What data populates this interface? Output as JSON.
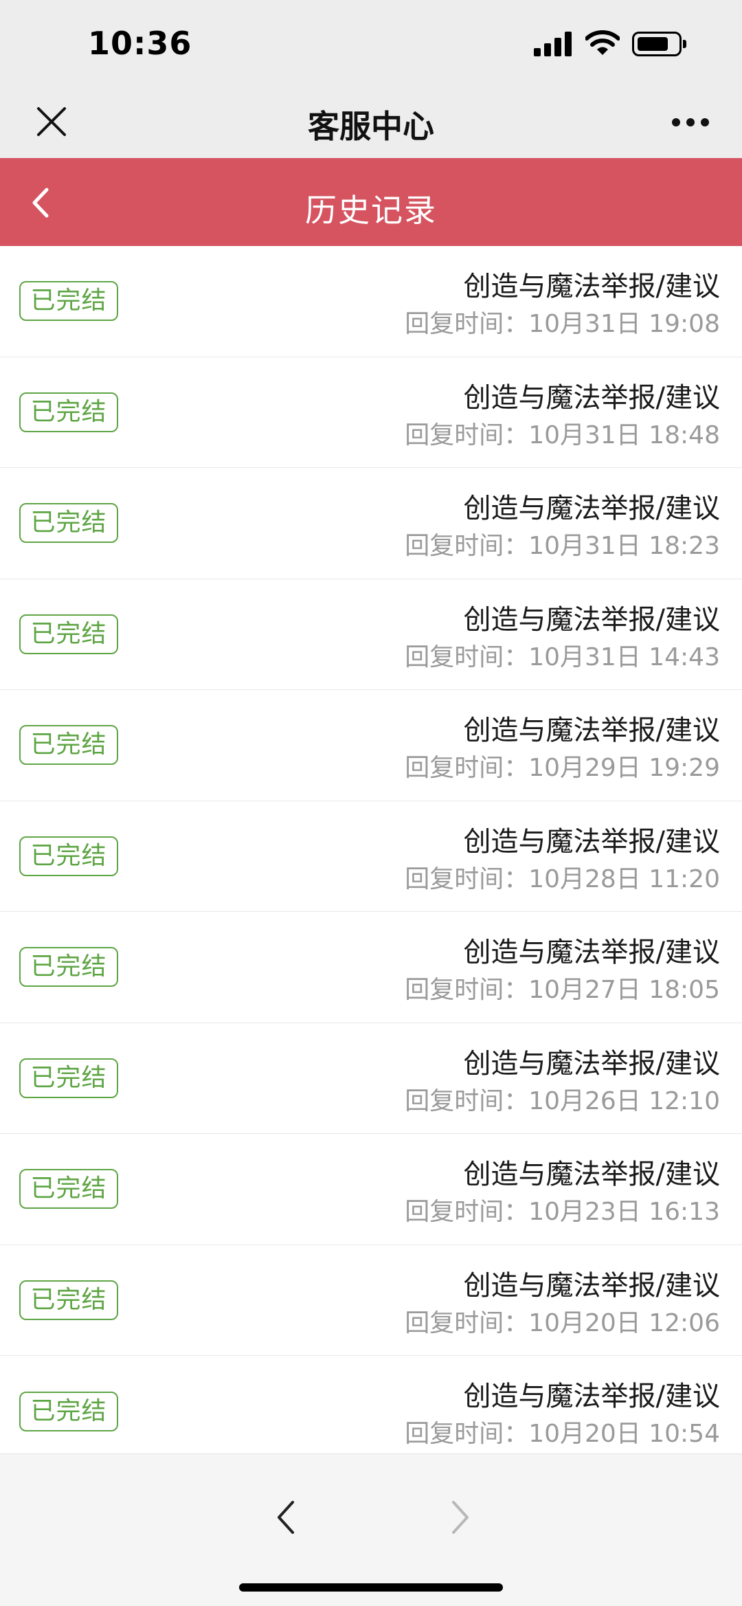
{
  "status_bar": {
    "time": "10:36"
  },
  "header": {
    "title": "客服中心",
    "close_icon": "close-icon",
    "more_icon": "more-icon"
  },
  "sub_header": {
    "title": "历史记录",
    "back_icon": "chevron-left-icon",
    "color": "#d55460"
  },
  "records": [
    {
      "status": "已完结",
      "title": "创造与魔法举报/建议",
      "time": "回复时间：10月31日 19:08"
    },
    {
      "status": "已完结",
      "title": "创造与魔法举报/建议",
      "time": "回复时间：10月31日 18:48"
    },
    {
      "status": "已完结",
      "title": "创造与魔法举报/建议",
      "time": "回复时间：10月31日 18:23"
    },
    {
      "status": "已完结",
      "title": "创造与魔法举报/建议",
      "time": "回复时间：10月31日 14:43"
    },
    {
      "status": "已完结",
      "title": "创造与魔法举报/建议",
      "time": "回复时间：10月29日 19:29"
    },
    {
      "status": "已完结",
      "title": "创造与魔法举报/建议",
      "time": "回复时间：10月28日 11:20"
    },
    {
      "status": "已完结",
      "title": "创造与魔法举报/建议",
      "time": "回复时间：10月27日 18:05"
    },
    {
      "status": "已完结",
      "title": "创造与魔法举报/建议",
      "time": "回复时间：10月26日 12:10"
    },
    {
      "status": "已完结",
      "title": "创造与魔法举报/建议",
      "time": "回复时间：10月23日 16:13"
    },
    {
      "status": "已完结",
      "title": "创造与魔法举报/建议",
      "time": "回复时间：10月20日 12:06"
    },
    {
      "status": "已完结",
      "title": "创造与魔法举报/建议",
      "time": "回复时间：10月20日 10:54"
    }
  ],
  "colors": {
    "badge_green": "#5ea544",
    "accent_red": "#d55460"
  }
}
